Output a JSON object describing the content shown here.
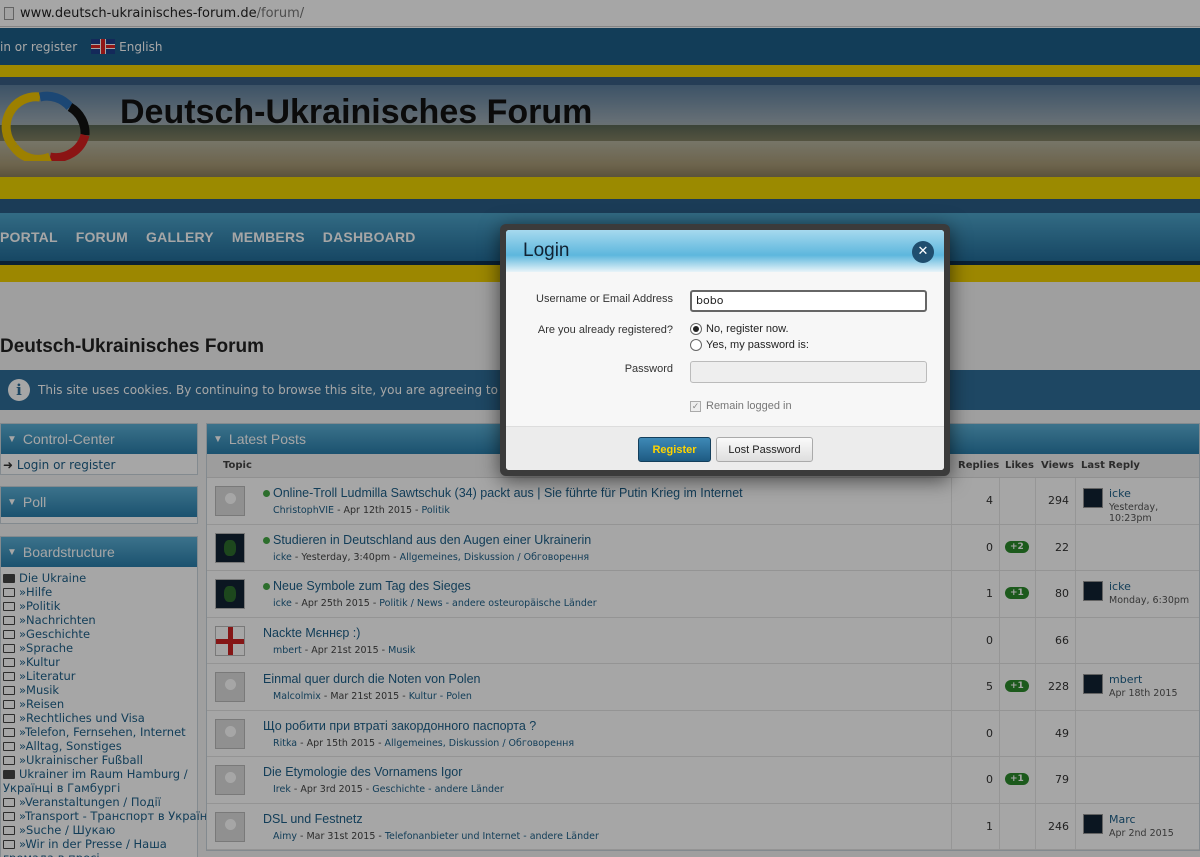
{
  "browser": {
    "url_domain": "www.deutsch-ukrainisches-forum.de",
    "url_path": "/forum/"
  },
  "userbar": {
    "login": "in or register",
    "language": "English"
  },
  "site": {
    "title": "Deutsch-Ukrainisches Forum"
  },
  "nav": [
    "PORTAL",
    "FORUM",
    "GALLERY",
    "MEMBERS",
    "DASHBOARD"
  ],
  "page": {
    "heading": "Deutsch-Ukrainisches Forum",
    "cookie_notice": "This site uses cookies. By continuing to browse this site, you are agreeing to our use of coo"
  },
  "sidebar": {
    "control_center": {
      "title": "Control-Center",
      "link": "Login or register"
    },
    "poll": {
      "title": "Poll"
    },
    "boardstructure": {
      "title": "Boardstructure",
      "items": [
        {
          "label": "Die Ukraine",
          "open": true
        },
        {
          "label": "»Hilfe",
          "open": false
        },
        {
          "label": "»Politik",
          "open": false
        },
        {
          "label": "»Nachrichten",
          "open": false
        },
        {
          "label": "»Geschichte",
          "open": false
        },
        {
          "label": "»Sprache",
          "open": false
        },
        {
          "label": "»Kultur",
          "open": false
        },
        {
          "label": "»Literatur",
          "open": false
        },
        {
          "label": "»Musik",
          "open": false
        },
        {
          "label": "»Reisen",
          "open": false
        },
        {
          "label": "»Rechtliches und Visa",
          "open": false
        },
        {
          "label": "»Telefon, Fernsehen, Internet",
          "open": false
        },
        {
          "label": "»Alltag, Sonstiges",
          "open": false
        },
        {
          "label": "»Ukrainischer Fußball",
          "open": false
        },
        {
          "label": "Ukrainer im Raum Hamburg /",
          "open": true
        },
        {
          "label": "Українці в Гамбургі",
          "open": null
        },
        {
          "label": "»Veranstaltungen / Події",
          "open": false
        },
        {
          "label": "»Transport - Транспорт в Україну",
          "open": false
        },
        {
          "label": "»Suche / Шукаю",
          "open": false
        },
        {
          "label": "»Wir in der Presse / Наша",
          "open": false
        },
        {
          "label": "громада в пресі",
          "open": null
        }
      ]
    }
  },
  "latest_posts": {
    "title": "Latest Posts",
    "columns": {
      "topic": "Topic",
      "replies": "Replies",
      "likes": "Likes",
      "views": "Views",
      "last_reply": "Last Reply"
    },
    "rows": [
      {
        "avatar": "gray",
        "new": true,
        "title": "Online-Troll Ludmilla Sawtschuk (34) packt aus | Sie führte für Putin Krieg im Internet",
        "author": "ChristophVIE",
        "date": " - Apr 12th 2015 - ",
        "category": "Politik",
        "replies": "4",
        "likes": "",
        "views": "294",
        "last_user": "icke",
        "last_time": "Yesterday, 10:23pm"
      },
      {
        "avatar": "dark",
        "new": true,
        "title": "Studieren in Deutschland aus den Augen einer Ukrainerin",
        "author": "icke",
        "date": " - Yesterday, 3:40pm - ",
        "category": "Allgemeines, Diskussion / Обговорення",
        "replies": "0",
        "likes": "+2",
        "views": "22",
        "last_user": "",
        "last_time": ""
      },
      {
        "avatar": "dark",
        "new": true,
        "title": "Neue Symbole zum Tag des Sieges",
        "author": "icke",
        "date": " - Apr 25th 2015 - ",
        "category": "Politik / News - andere osteuropäische Länder",
        "replies": "1",
        "likes": "+1",
        "views": "80",
        "last_user": "icke",
        "last_time": "Monday, 6:30pm"
      },
      {
        "avatar": "flag",
        "new": false,
        "title": "Nackte Мєннєр :)",
        "author": "mbert",
        "date": " - Apr 21st 2015 - ",
        "category": "Musik",
        "replies": "0",
        "likes": "",
        "views": "66",
        "last_user": "",
        "last_time": ""
      },
      {
        "avatar": "gray",
        "new": false,
        "title": "Einmal quer durch die Noten von Polen",
        "author": "Malcolmix",
        "date": " - Mar 21st 2015 - ",
        "category": "Kultur - Polen",
        "replies": "5",
        "likes": "+1",
        "views": "228",
        "last_user": "mbert",
        "last_time": "Apr 18th 2015"
      },
      {
        "avatar": "gray",
        "new": false,
        "title": "Що робити при втраті закордонного паспорта ?",
        "author": "Ritka",
        "date": " - Apr 15th 2015 - ",
        "category": "Allgemeines, Diskussion / Обговорення",
        "replies": "0",
        "likes": "",
        "views": "49",
        "last_user": "",
        "last_time": ""
      },
      {
        "avatar": "gray",
        "new": false,
        "title": "Die Etymologie des Vornamens Igor",
        "author": "Irek",
        "date": " - Apr 3rd 2015 - ",
        "category": "Geschichte - andere Länder",
        "replies": "0",
        "likes": "+1",
        "views": "79",
        "last_user": "",
        "last_time": ""
      },
      {
        "avatar": "gray",
        "new": false,
        "title": "DSL und Festnetz",
        "author": "Aimy",
        "date": " - Mar 31st 2015 - ",
        "category": "Telefonanbieter und Internet - andere Länder",
        "replies": "1",
        "likes": "",
        "views": "246",
        "last_user": "Marc",
        "last_time": "Apr 2nd 2015"
      }
    ]
  },
  "login_dialog": {
    "title": "Login",
    "username_label": "Username or Email Address",
    "username_value": "bobo",
    "registered_label": "Are you already registered?",
    "option_no": "No, register now.",
    "option_yes": "Yes, my password is:",
    "password_label": "Password",
    "remember": "Remain logged in",
    "register_button": "Register",
    "lost_password_button": "Lost Password"
  }
}
